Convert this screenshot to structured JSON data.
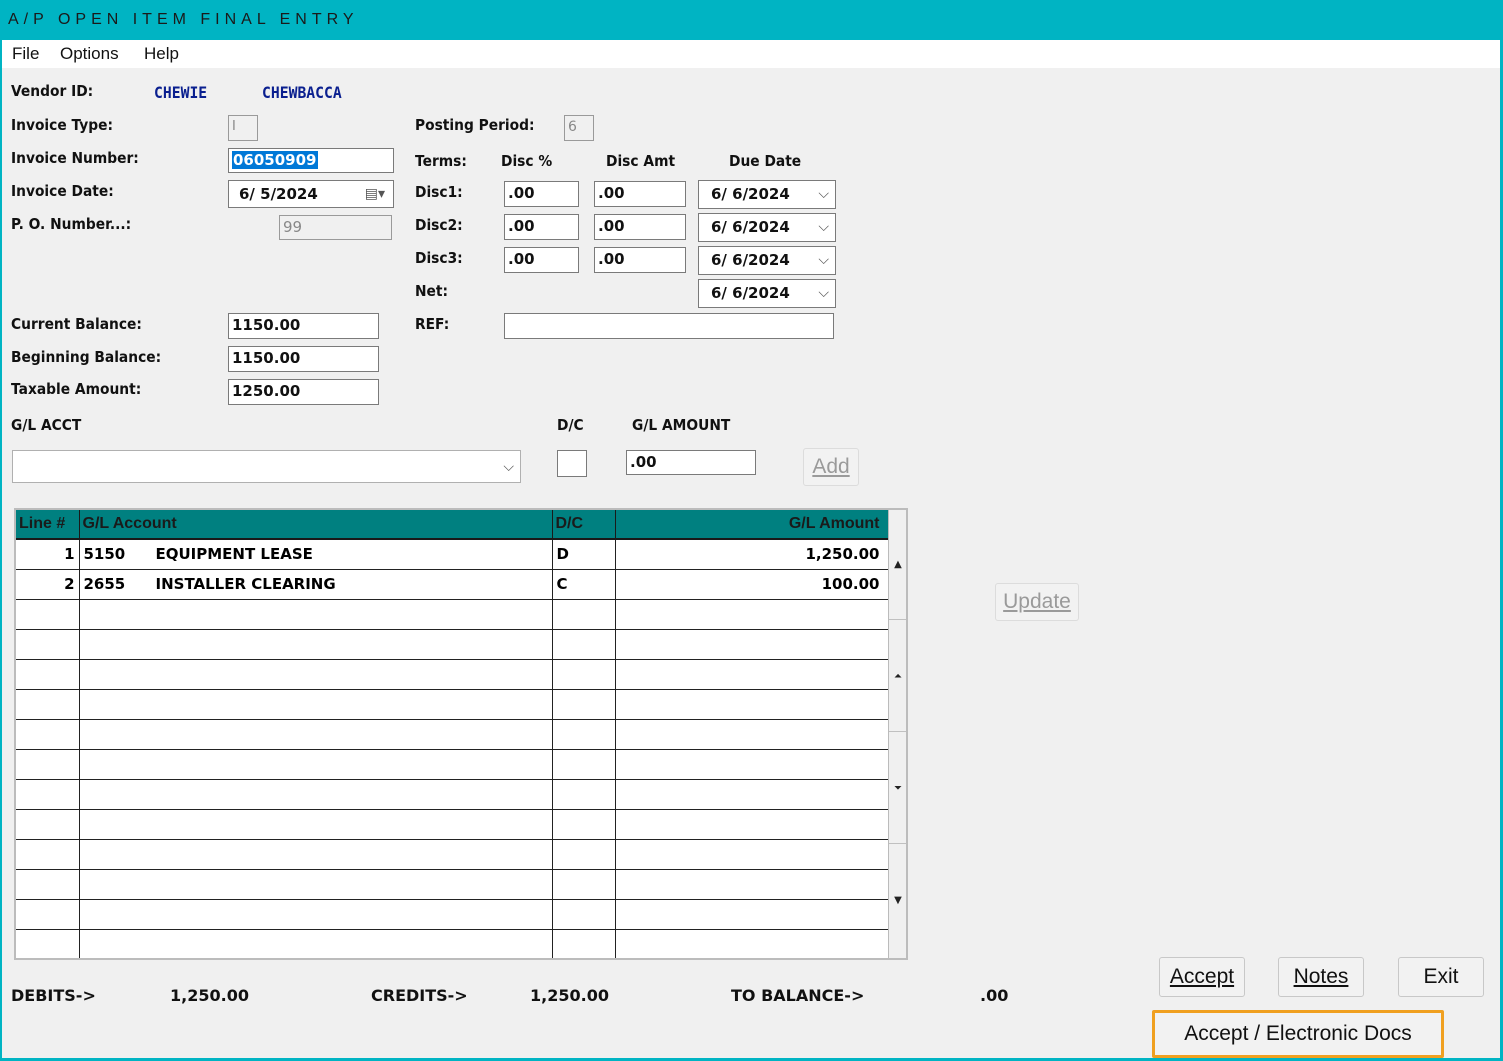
{
  "window": {
    "title": "A/P  OPEN ITEM FINAL ENTRY"
  },
  "menu": {
    "file": "File",
    "options": "Options",
    "help": "Help"
  },
  "vendor": {
    "label": "Vendor ID:",
    "id": "CHEWIE",
    "name": "CHEWBACCA"
  },
  "invoice": {
    "type_label": "Invoice Type:",
    "type_value": "I",
    "number_label": "Invoice Number:",
    "number_value": "06050909",
    "date_label": "Invoice Date:",
    "date_value": "6/ 5/2024",
    "po_label": "P. O. Number...:",
    "po_value": "99"
  },
  "posting": {
    "label": "Posting Period:",
    "value": "6"
  },
  "terms": {
    "label": "Terms:",
    "disc_pct_header": "Disc %",
    "disc_amt_header": "Disc Amt",
    "due_date_header": "Due Date",
    "rows": [
      {
        "label": "Disc1:",
        "pct": ".00",
        "amt": ".00",
        "due": "6/ 6/2024"
      },
      {
        "label": "Disc2:",
        "pct": ".00",
        "amt": ".00",
        "due": "6/ 6/2024"
      },
      {
        "label": "Disc3:",
        "pct": ".00",
        "amt": ".00",
        "due": "6/ 6/2024"
      }
    ],
    "net_label": "Net:",
    "net_due": "6/ 6/2024",
    "ref_label": "REF:",
    "ref_value": ""
  },
  "balances": {
    "current_label": "Current Balance:",
    "current_value": "1150.00",
    "beginning_label": "Beginning Balance:",
    "beginning_value": "1150.00",
    "taxable_label": "Taxable Amount:",
    "taxable_value": "1250.00"
  },
  "gl_entry": {
    "acct_label": "G/L ACCT",
    "dc_label": "D/C",
    "amount_label": "G/L AMOUNT",
    "acct_value": "",
    "dc_value": "",
    "amount_value": ".00",
    "add_button": "Add"
  },
  "grid": {
    "columns": [
      "Line #",
      "G/L Account",
      "D/C",
      "G/L Amount"
    ],
    "rows": [
      {
        "line": "1",
        "acct": "5150",
        "desc": "EQUIPMENT LEASE",
        "dc": "D",
        "amount": "1,250.00"
      },
      {
        "line": "2",
        "acct": "2655",
        "desc": "INSTALLER CLEARING",
        "dc": "C",
        "amount": "100.00"
      }
    ]
  },
  "update_button": "Update",
  "totals": {
    "debits_label": "DEBITS->",
    "debits_value": "1,250.00",
    "credits_label": "CREDITS->",
    "credits_value": "1,250.00",
    "balance_label": "TO BALANCE->",
    "balance_value": ".00"
  },
  "buttons": {
    "accept": "Accept",
    "notes": "Notes",
    "exit": "Exit",
    "accept_docs": "Accept / Electronic Docs"
  },
  "colors": {
    "titlebar": "#00b4c3",
    "grid_header": "#008080",
    "highlight_border": "#f0a020",
    "vendor_text": "#0a1f8f"
  }
}
